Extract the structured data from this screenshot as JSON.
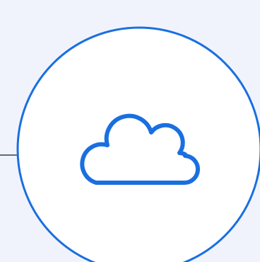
{
  "node": {
    "icon": "cloud-icon",
    "ring_color": "#1a6fe0",
    "icon_color": "#1a6fe0",
    "fill_color": "#ffffff",
    "connector_color": "#5f6b7a"
  }
}
